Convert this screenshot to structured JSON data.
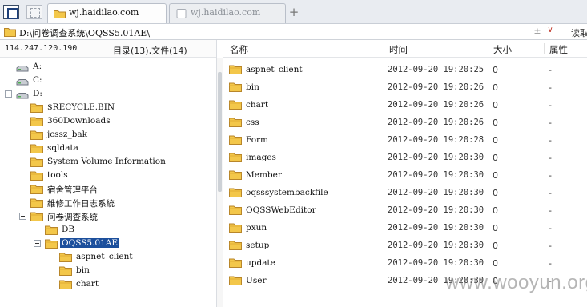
{
  "tabbar": {
    "active_tab": {
      "label": "wj.haidilao.com"
    },
    "inactive_tab": {
      "label": "wj.haidilao.com"
    },
    "add_tab_symbol": "+"
  },
  "address": {
    "path": "D:\\问卷调查系统\\OQSS5.01AE\\",
    "arrows_symbol": "±",
    "dropdown_symbol": "∨",
    "read_button": "读取"
  },
  "left_panel": {
    "ip": "114.247.120.190",
    "counts": "目录(13),文件(14)",
    "tree": [
      {
        "label": "A:",
        "type": "drive",
        "level": 0,
        "toggle": false
      },
      {
        "label": "C:",
        "type": "drive",
        "level": 0,
        "toggle": false
      },
      {
        "label": "D:",
        "type": "drive",
        "level": 0,
        "toggle": true
      },
      {
        "label": "$RECYCLE.BIN",
        "type": "folder",
        "level": 1,
        "toggle": false
      },
      {
        "label": "360Downloads",
        "type": "folder",
        "level": 1,
        "toggle": false
      },
      {
        "label": "jcssz_bak",
        "type": "folder",
        "level": 1,
        "toggle": false
      },
      {
        "label": "sqldata",
        "type": "folder",
        "level": 1,
        "toggle": false
      },
      {
        "label": "System Volume Information",
        "type": "folder",
        "level": 1,
        "toggle": false
      },
      {
        "label": "tools",
        "type": "folder",
        "level": 1,
        "toggle": false
      },
      {
        "label": "宿舍管理平台",
        "type": "folder",
        "level": 1,
        "toggle": false
      },
      {
        "label": "維修工作日志系統",
        "type": "folder",
        "level": 1,
        "toggle": false
      },
      {
        "label": "问卷调查系统",
        "type": "folder",
        "level": 1,
        "toggle": true
      },
      {
        "label": "DB",
        "type": "folder",
        "level": 2,
        "toggle": false
      },
      {
        "label": "OQSS5.01AE",
        "type": "folder",
        "level": 2,
        "toggle": true,
        "selected": true
      },
      {
        "label": "aspnet_client",
        "type": "folder",
        "level": 3,
        "toggle": false
      },
      {
        "label": "bin",
        "type": "folder",
        "level": 3,
        "toggle": false
      },
      {
        "label": "chart",
        "type": "folder",
        "level": 3,
        "toggle": false
      }
    ]
  },
  "list": {
    "columns": {
      "name": "名称",
      "time": "时间",
      "size": "大小",
      "attr": "属性"
    },
    "rows": [
      {
        "name": "aspnet_client",
        "time": "2012-09-20 19:20:25",
        "size": "0",
        "attr": "-"
      },
      {
        "name": "bin",
        "time": "2012-09-20 19:20:26",
        "size": "0",
        "attr": "-"
      },
      {
        "name": "chart",
        "time": "2012-09-20 19:20:26",
        "size": "0",
        "attr": "-"
      },
      {
        "name": "css",
        "time": "2012-09-20 19:20:26",
        "size": "0",
        "attr": "-"
      },
      {
        "name": "Form",
        "time": "2012-09-20 19:20:28",
        "size": "0",
        "attr": "-"
      },
      {
        "name": "images",
        "time": "2012-09-20 19:20:30",
        "size": "0",
        "attr": "-"
      },
      {
        "name": "Member",
        "time": "2012-09-20 19:20:30",
        "size": "0",
        "attr": "-"
      },
      {
        "name": "oqsssystembackfile",
        "time": "2012-09-20 19:20:30",
        "size": "0",
        "attr": "-"
      },
      {
        "name": "OQSSWebEditor",
        "time": "2012-09-20 19:20:30",
        "size": "0",
        "attr": "-"
      },
      {
        "name": "pxun",
        "time": "2012-09-20 19:20:30",
        "size": "0",
        "attr": "-"
      },
      {
        "name": "setup",
        "time": "2012-09-20 19:20:30",
        "size": "0",
        "attr": "-"
      },
      {
        "name": "update",
        "time": "2012-09-20 19:20:30",
        "size": "0",
        "attr": "-"
      },
      {
        "name": "User",
        "time": "2012-09-20 19:20:30",
        "size": "0",
        "attr": "-"
      }
    ]
  },
  "watermark": "www.wooyun.org",
  "colors": {
    "folder": "#f3c74a",
    "selection": "#1c4f9c"
  }
}
